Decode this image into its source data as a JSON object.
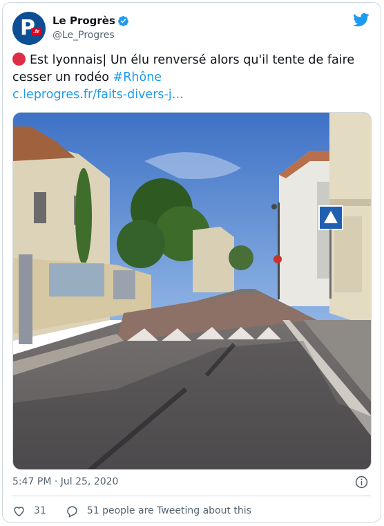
{
  "account": {
    "display_name": "Le Progrès",
    "handle": "@Le_Progres",
    "avatar_text": "P",
    "avatar_badge": ".fr"
  },
  "tweet": {
    "emoji": "red-circle",
    "text_main": "Est lyonnais| Un élu renversé alors qu'il tente de faire cesser un rodéo",
    "hashtag": "#Rhône",
    "link": "c.leprogres.fr/faits-divers-j…"
  },
  "timestamp": "5:47 PM · Jul 25, 2020",
  "actions": {
    "likes": "31",
    "conversation": "51 people are Tweeting about this"
  },
  "colors": {
    "accent": "#1d9bf0",
    "brand": "#0d4f95",
    "red": "#dd2e44"
  }
}
